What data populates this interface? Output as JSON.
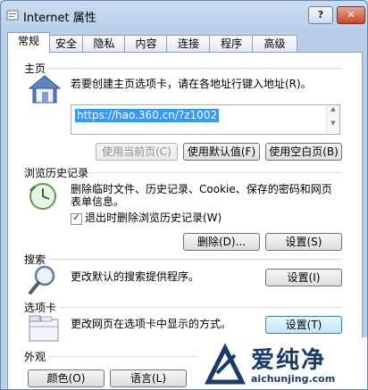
{
  "window": {
    "title": "Internet 属性",
    "help_label": "?",
    "close_label": "✕"
  },
  "tabs": [
    "常规",
    "安全",
    "隐私",
    "内容",
    "连接",
    "程序",
    "高级"
  ],
  "home": {
    "label": "主页",
    "description": "若要创建主页选项卡，请在各地址行键入地址(R)。",
    "url": "https://hao.360.cn/?z1002",
    "buttons": {
      "current": "使用当前页(C)",
      "default": "使用默认值(F)",
      "blank": "使用空白页(B)"
    }
  },
  "history": {
    "label": "浏览历史记录",
    "description_line1": "删除临时文件、历史记录、Cookie、保存的密码和网页",
    "description_line2": "表单信息。",
    "checkbox_label": "退出时删除浏览历史记录(W)",
    "checkbox_checked": true,
    "buttons": {
      "delete": "删除(D)...",
      "settings": "设置(S)"
    }
  },
  "search": {
    "label": "搜索",
    "description": "更改默认的搜索提供程序。",
    "settings": "设置(I)"
  },
  "tabs_section": {
    "label": "选项卡",
    "description": "更改网页在选项卡中显示的方式。",
    "settings": "设置(T)"
  },
  "appearance": {
    "label": "外观",
    "buttons": {
      "colors": "颜色(O)",
      "languages": "语言(L)"
    }
  },
  "watermark": {
    "brand": "爱纯净",
    "url": "aichunjing.com"
  }
}
